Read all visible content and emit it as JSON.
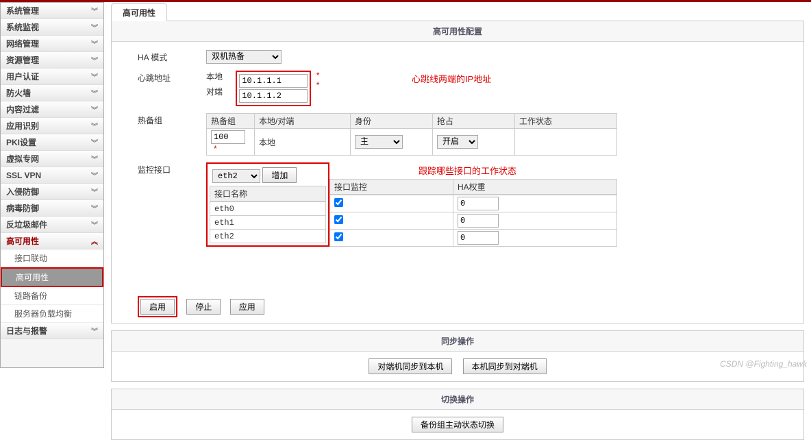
{
  "tab_title": "高可用性",
  "sidebar": {
    "items": [
      {
        "label": "系统管理",
        "expanded": false
      },
      {
        "label": "系统监视",
        "expanded": false
      },
      {
        "label": "网络管理",
        "expanded": false
      },
      {
        "label": "资源管理",
        "expanded": false
      },
      {
        "label": "用户认证",
        "expanded": false
      },
      {
        "label": "防火墙",
        "expanded": false
      },
      {
        "label": "内容过滤",
        "expanded": false
      },
      {
        "label": "应用识别",
        "expanded": false
      },
      {
        "label": "PKI设置",
        "expanded": false
      },
      {
        "label": "虚拟专网",
        "expanded": false
      },
      {
        "label": "SSL VPN",
        "expanded": false
      },
      {
        "label": "入侵防御",
        "expanded": false
      },
      {
        "label": "病毒防御",
        "expanded": false
      },
      {
        "label": "反垃圾邮件",
        "expanded": false
      },
      {
        "label": "高可用性",
        "expanded": true,
        "subs": [
          {
            "label": "接口联动",
            "selected": false
          },
          {
            "label": "高可用性",
            "selected": true
          },
          {
            "label": "链路备份",
            "selected": false
          },
          {
            "label": "服务器负载均衡",
            "selected": false
          }
        ]
      },
      {
        "label": "日志与报警",
        "expanded": false
      }
    ]
  },
  "section_config_title": "高可用性配置",
  "ha_mode": {
    "label": "HA 模式",
    "value": "双机热备"
  },
  "heartbeat": {
    "label": "心跳地址",
    "local_label": "本地",
    "local_value": "10.1.1.1",
    "peer_label": "对端",
    "peer_value": "10.1.1.2",
    "annotation": "心跳线两端的IP地址"
  },
  "backup_group": {
    "label": "热备组",
    "headers": [
      "热备组",
      "本地/对端",
      "身份",
      "抢占",
      "工作状态"
    ],
    "row": {
      "group": "100",
      "local_peer": "本地",
      "role": "主",
      "preempt": "开启",
      "status": ""
    }
  },
  "monitor": {
    "label": "监控接口",
    "iface_select": "eth2",
    "add_btn": "增加",
    "annotation": "跟踪哪些接口的工作状态",
    "headers": [
      "接口名称",
      "接口监控",
      "HA权重"
    ],
    "rows": [
      {
        "name": "eth0",
        "checked": true,
        "weight": "0"
      },
      {
        "name": "eth1",
        "checked": true,
        "weight": "0"
      },
      {
        "name": "eth2",
        "checked": true,
        "weight": "0"
      }
    ]
  },
  "buttons": {
    "enable": "启用",
    "stop": "停止",
    "apply": "应用"
  },
  "sync": {
    "title": "同步操作",
    "peer_to_local": "对端机同步到本机",
    "local_to_peer": "本机同步到对端机"
  },
  "switch": {
    "title": "切换操作",
    "btn": "备份组主动状态切换"
  },
  "watermark": "CSDN @Fighting_hawk"
}
